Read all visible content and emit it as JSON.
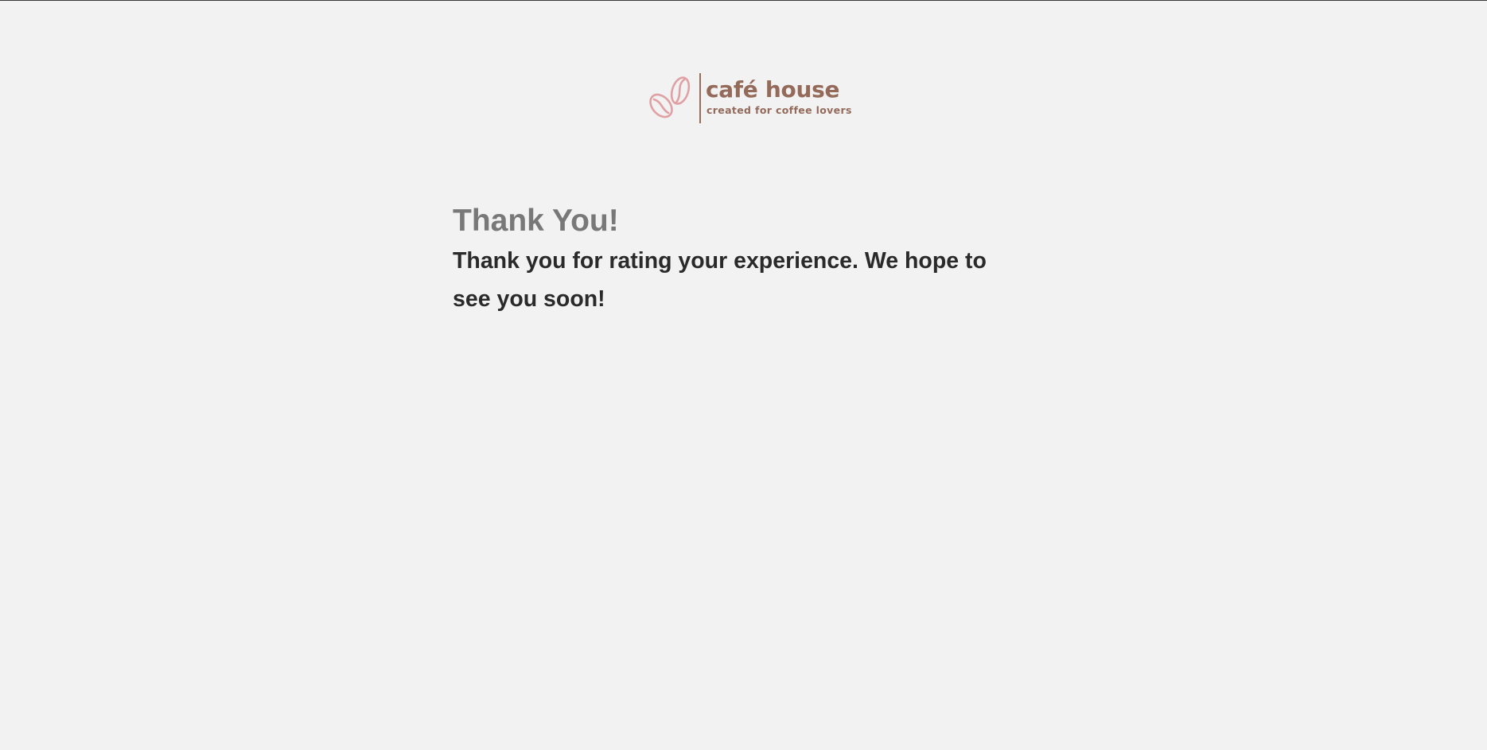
{
  "logo": {
    "icon": "coffee-beans-icon",
    "name": "café house",
    "tagline": "created for coffee lovers"
  },
  "main": {
    "title": "Thank You!",
    "message": "Thank you for rating your experience. We hope to see you soon!"
  },
  "colors": {
    "background": "#f2f2f2",
    "brand_text": "#946a5b",
    "bean_pink": "#e0a1a4",
    "title_gray": "#787878",
    "message_dark": "#2a2a2a"
  }
}
